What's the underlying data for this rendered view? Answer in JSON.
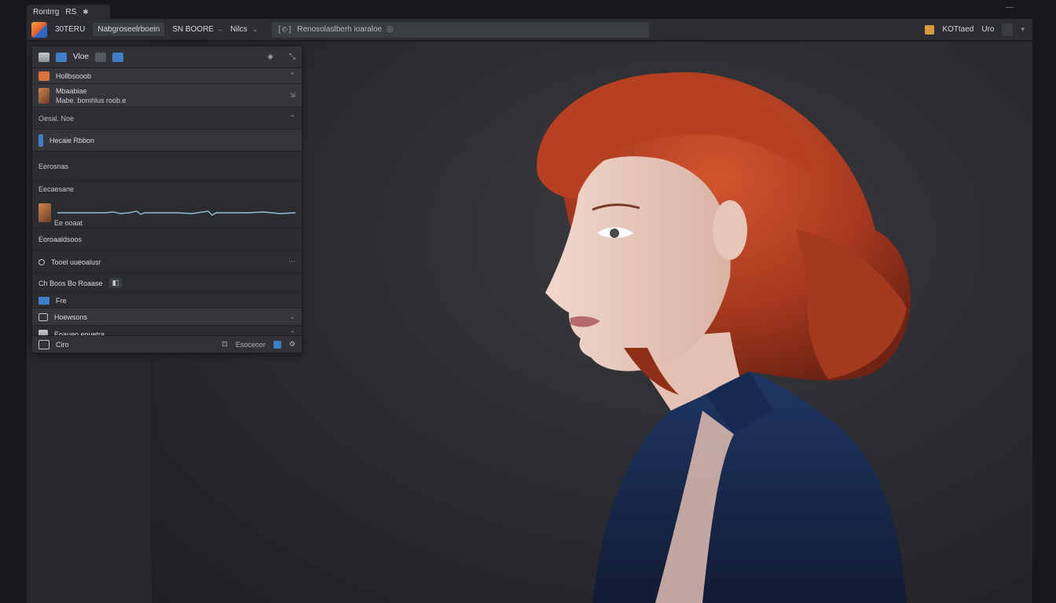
{
  "window": {
    "tab_label": "Rontrrg",
    "tab_extra": "RS"
  },
  "menubar": {
    "items": [
      {
        "label": "30TERU",
        "boxed": false
      },
      {
        "label": "Nabgroseelrboein",
        "boxed": true
      },
      {
        "label": "SN BOORE",
        "boxed": false
      },
      {
        "label": "Nilcs",
        "boxed": false
      }
    ],
    "search_value": "Renosolaslberh ioaraloe",
    "right_items": [
      "KOTtaed",
      "Uro"
    ]
  },
  "panel": {
    "header_title": "Vloe",
    "rows": [
      {
        "label": "Hollbsooob"
      },
      {
        "label": "Mbaabiae",
        "sub": "Mabe. bomhlus roob.e"
      },
      {
        "label": "Oesal. Noe"
      },
      {
        "label": "Hecaie Rbbon"
      },
      {
        "label": "Eerosnas"
      },
      {
        "label": "Eecaesane"
      },
      {
        "label": "Eoroaaldsoos"
      },
      {
        "label": "Tooel uueoalusr"
      },
      {
        "label": "Ch Boos Bo Roaase"
      },
      {
        "label": "Fre"
      },
      {
        "label": "Hoewsons"
      },
      {
        "label": "Eoaueo enuetra"
      }
    ],
    "wave_label": "Ee ooaat",
    "footer_label": "Ciro",
    "footer_right": "Esoceoor"
  },
  "colors": {
    "menubar_bg": "#2b2d31",
    "panel_bg": "#2a2c30",
    "accent_blue": "#3f7fc8",
    "accent_orange": "#d9733a",
    "hair": "#b8432a",
    "dress": "#1b2e52",
    "waveform": "#8fc1d9"
  }
}
